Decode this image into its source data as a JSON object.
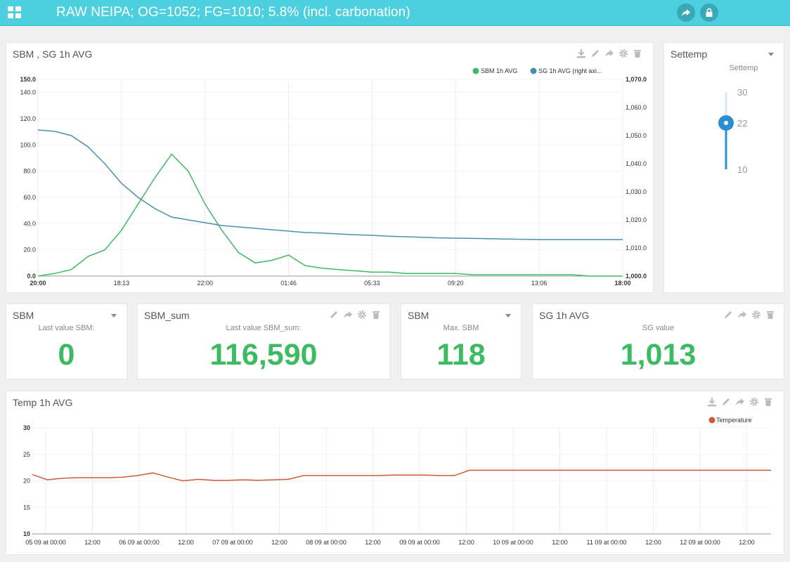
{
  "header": {
    "title": "RAW NEIPA; OG=1052; FG=1010; 5.8% (incl. carbonation)"
  },
  "colors": {
    "header_bg": "#4ccfdf",
    "green": "#3dbb63",
    "blue": "#4a8fb0",
    "red": "#d05a3c",
    "slider": "#2a8fd0"
  },
  "chart1": {
    "title": "SBM , SG 1h AVG",
    "legend": [
      "SBM 1h AVG",
      "SG 1h AVG (right axi..."
    ],
    "left_ticks": [
      "150.0",
      "140.0",
      "120.0",
      "100.0",
      "80.0",
      "60.0",
      "40.0",
      "20.0",
      "0.0"
    ],
    "right_ticks": [
      "1,070.0",
      "1,060.0",
      "1,050.0",
      "1,040.0",
      "1,030.0",
      "1,020.0",
      "1,010.0",
      "1,000.0"
    ],
    "x_ticks": [
      "20:00",
      "18:13",
      "22:00",
      "01:46",
      "05:33",
      "09:20",
      "13:06",
      "18:00"
    ]
  },
  "settemp": {
    "title": "Settemp",
    "label": "Settemp",
    "ticks": [
      "30",
      "22",
      "10"
    ],
    "value": 22,
    "min": 10,
    "max": 30
  },
  "stats": {
    "sbm_last": {
      "title": "SBM",
      "label": "Last value SBM:",
      "value": "0"
    },
    "sbm_sum": {
      "title": "SBM_sum",
      "label": "Last value SBM_sum:",
      "value": "116,590"
    },
    "sbm_max": {
      "title": "SBM",
      "label": "Max. SBM",
      "value": "118"
    },
    "sg": {
      "title": "SG 1h AVG",
      "label": "SG value",
      "value": "1,013"
    }
  },
  "chart2": {
    "title": "Temp 1h AVG",
    "legend": [
      "Temperature"
    ],
    "y_ticks": [
      "30",
      "25",
      "20",
      "15",
      "10"
    ],
    "x_ticks": [
      "05 09 at 00:00",
      "12:00",
      "06 09 at 00:00",
      "12:00",
      "07 09 at 00:00",
      "12:00",
      "08 09 at 00:00",
      "12:00",
      "09 09 at 00:00",
      "12:00",
      "10 09 at 00:00",
      "12:00",
      "11 09 at 00:00",
      "12:00",
      "12 09 at 00:00",
      "12:00"
    ]
  },
  "chart_data": [
    {
      "type": "line",
      "title": "SBM , SG 1h AVG",
      "x": [
        "20:00",
        "18:13",
        "22:00",
        "01:46",
        "05:33",
        "09:20",
        "13:06",
        "18:00"
      ],
      "ylim_left": [
        0,
        150
      ],
      "ylim_right": [
        1000,
        1070
      ],
      "series": [
        {
          "name": "SBM 1h AVG",
          "axis": "left",
          "values": [
            0,
            2,
            5,
            15,
            20,
            35,
            55,
            75,
            93,
            80,
            55,
            35,
            18,
            10,
            12,
            16,
            8,
            6,
            5,
            4,
            3,
            3,
            2,
            2,
            2,
            2,
            1,
            1,
            1,
            1,
            1,
            1,
            1,
            0,
            0,
            0
          ]
        },
        {
          "name": "SG 1h AVG (right axis)",
          "axis": "right",
          "values": [
            1052,
            1051.5,
            1050,
            1046,
            1040,
            1033,
            1028,
            1024,
            1021,
            1020,
            1019,
            1018,
            1017.5,
            1017,
            1016.5,
            1016,
            1015.5,
            1015.3,
            1015,
            1014.7,
            1014.5,
            1014.2,
            1014,
            1013.8,
            1013.6,
            1013.5,
            1013.4,
            1013.3,
            1013.2,
            1013.1,
            1013,
            1013,
            1013,
            1013,
            1013,
            1013
          ]
        }
      ]
    },
    {
      "type": "line",
      "title": "Temp 1h AVG",
      "ylim": [
        10,
        30
      ],
      "series": [
        {
          "name": "Temperature",
          "values": [
            21.2,
            20.2,
            20.5,
            20.6,
            20.6,
            20.6,
            20.7,
            21.0,
            21.5,
            20.7,
            20.0,
            20.3,
            20.1,
            20.1,
            20.2,
            20.1,
            20.2,
            20.3,
            21.0,
            21.0,
            21.0,
            21.0,
            21.0,
            21.0,
            21.1,
            21.1,
            21.1,
            21.0,
            21.0,
            22.0,
            22.0,
            22.0,
            22.0,
            22.0,
            22.0,
            22.0,
            22.0,
            22.0,
            22.0,
            22.0,
            22.0,
            22.0,
            22.0,
            22.0,
            22.0,
            22.0,
            22.0,
            22.0,
            22.0,
            22.0
          ]
        }
      ]
    }
  ]
}
